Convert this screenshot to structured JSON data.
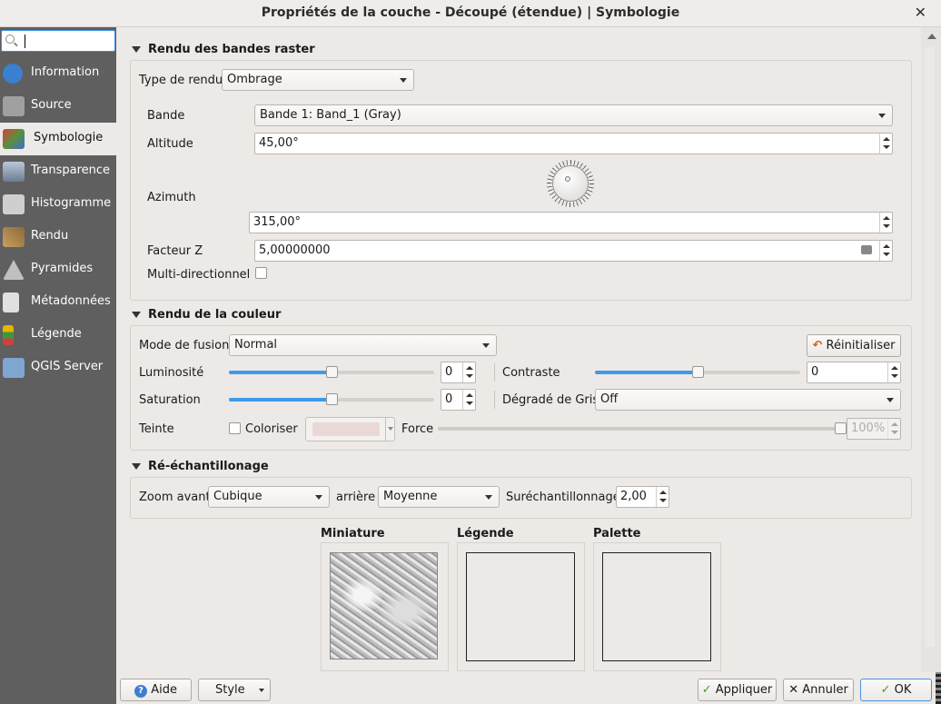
{
  "window": {
    "title": "Propriétés de la couche - Découpé (étendue) | Symbologie",
    "close_glyph": "✕"
  },
  "sidebar": {
    "search_placeholder": "",
    "items": [
      {
        "label": "Information",
        "icon": "info-icon",
        "color": "#3a7fd0"
      },
      {
        "label": "Source",
        "icon": "wrench-icon",
        "color": "#a0a0a0"
      },
      {
        "label": "Symbologie",
        "icon": "paintbrush-icon",
        "color": "#5a8f3a"
      },
      {
        "label": "Transparence",
        "icon": "transparency-icon",
        "color": "#b9c7d8"
      },
      {
        "label": "Histogramme",
        "icon": "histogram-icon",
        "color": "#cfcfcf"
      },
      {
        "label": "Rendu",
        "icon": "brush-icon",
        "color": "#c8a060"
      },
      {
        "label": "Pyramides",
        "icon": "pyramid-icon",
        "color": "#c0c0c0"
      },
      {
        "label": "Métadonnées",
        "icon": "metadata-icon",
        "color": "#e0e0e0"
      },
      {
        "label": "Légende",
        "icon": "legend-icon",
        "color": "#e6b400"
      },
      {
        "label": "QGIS Server",
        "icon": "server-icon",
        "color": "#7ea6d0"
      }
    ]
  },
  "raster_render": {
    "heading": "Rendu des bandes raster",
    "render_type_label": "Type de rendu",
    "render_type_value": "Ombrage",
    "band_label": "Bande",
    "band_value": "Bande 1: Band_1 (Gray)",
    "altitude_label": "Altitude",
    "altitude_value": "45,00°",
    "azimuth_label": "Azimuth",
    "azimuth_value": "315,00°",
    "zfactor_label": "Facteur Z",
    "zfactor_value": "5,00000000",
    "multidir_label": "Multi-directionnel"
  },
  "color_render": {
    "heading": "Rendu de la couleur",
    "blend_label": "Mode de fusion",
    "blend_value": "Normal",
    "reset_label": "Réinitialiser",
    "brightness_label": "Luminosité",
    "brightness_value": "0",
    "brightness_level": 0.5,
    "contrast_label": "Contraste",
    "contrast_value": "0",
    "contrast_level": 0.5,
    "saturation_label": "Saturation",
    "saturation_value": "0",
    "saturation_level": 0.5,
    "grayscale_label": "Dégradé de Gris",
    "grayscale_value": "Off",
    "hue_label": "Teinte",
    "colorize_label": "Coloriser",
    "strength_label": "Force",
    "strength_value": "100%",
    "strength_level": 1.0
  },
  "resampling": {
    "heading": "Ré-échantillonage",
    "zoom_in_label": "Zoom avant",
    "zoom_in_value": "Cubique",
    "zoom_out_label": "arrière",
    "zoom_out_value": "Moyenne",
    "oversampling_label": "Suréchantillonnage",
    "oversampling_value": "2,00"
  },
  "previews": {
    "thumbnail_label": "Miniature",
    "legend_label": "Légende",
    "palette_label": "Palette"
  },
  "footer": {
    "help_label": "Aide",
    "style_label": "Style",
    "apply_label": "Appliquer",
    "cancel_label": "Annuler",
    "ok_label": "OK"
  }
}
